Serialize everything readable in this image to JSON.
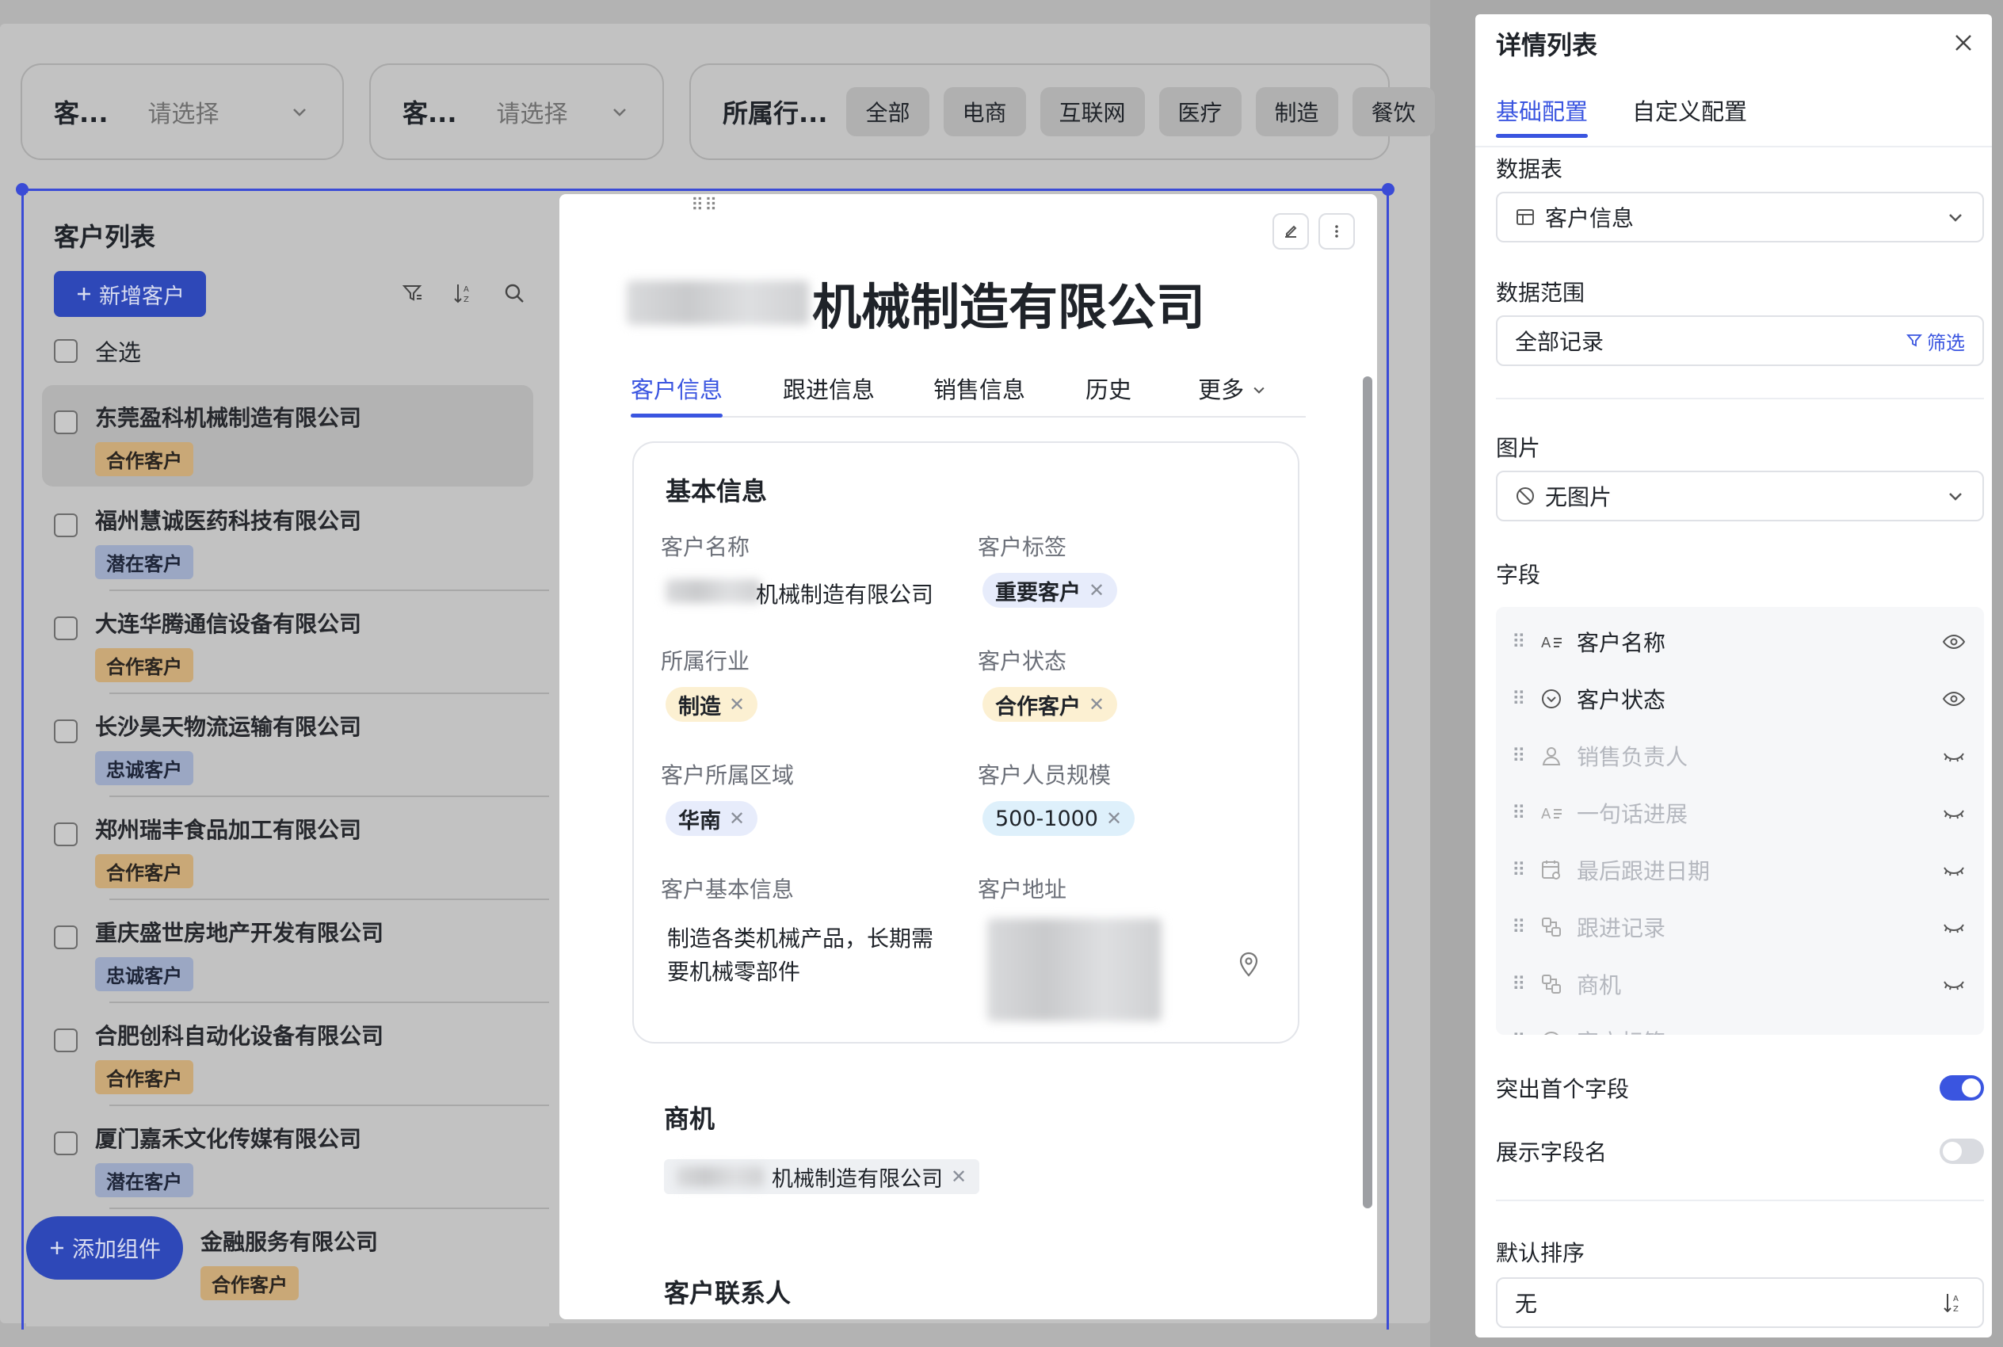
{
  "filters": [
    {
      "label": "客...",
      "placeholder": "请选择"
    },
    {
      "label": "客...",
      "placeholder": "请选择"
    },
    {
      "label": "所属行...",
      "chips": [
        "全部",
        "电商",
        "互联网",
        "医疗",
        "制造",
        "餐饮"
      ]
    }
  ],
  "customer_list": {
    "title": "客户列表",
    "add_button": "新增客户",
    "select_all": "全选",
    "items": [
      {
        "name": "东莞盈科机械制造有限公司",
        "status": "合作客户"
      },
      {
        "name": "福州慧诚医药科技有限公司",
        "status": "潜在客户"
      },
      {
        "name": "大连华腾通信设备有限公司",
        "status": "合作客户"
      },
      {
        "name": "长沙昊天物流运输有限公司",
        "status": "忠诚客户"
      },
      {
        "name": "郑州瑞丰食品加工有限公司",
        "status": "合作客户"
      },
      {
        "name": "重庆盛世房地产开发有限公司",
        "status": "忠诚客户"
      },
      {
        "name": "合肥创科自动化设备有限公司",
        "status": "合作客户"
      },
      {
        "name": "厦门嘉禾文化传媒有限公司",
        "status": "潜在客户"
      },
      {
        "name": "金融服务有限公司",
        "status": "合作客户"
      }
    ],
    "add_component_button": "添加组件"
  },
  "detail": {
    "title": "机械制造有限公司",
    "tabs": [
      "客户信息",
      "跟进信息",
      "销售信息",
      "历史",
      "更多"
    ],
    "basic_info": {
      "title": "基本信息",
      "fields": {
        "customer_name_label": "客户名称",
        "customer_name_value": "机械制造有限公司",
        "customer_tag_label": "客户标签",
        "customer_tag_value": "重要客户",
        "industry_label": "所属行业",
        "industry_value": "制造",
        "status_label": "客户状态",
        "status_value": "合作客户",
        "region_label": "客户所属区域",
        "region_value": "华南",
        "size_label": "客户人员规模",
        "size_value": "500-1000",
        "basic_info_label": "客户基本信息",
        "basic_info_value_line1": "制造各类机械产品，长期需",
        "basic_info_value_line2": "要机械零部件",
        "address_label": "客户地址"
      }
    },
    "opportunity": {
      "title": "商机",
      "value": "机械制造有限公司"
    },
    "contacts": {
      "title": "客户联系人"
    }
  },
  "config": {
    "title": "详情列表",
    "tabs": [
      "基础配置",
      "自定义配置"
    ],
    "datatable_label": "数据表",
    "datatable_value": "客户信息",
    "range_label": "数据范围",
    "range_value": "全部记录",
    "range_filter": "筛选",
    "image_label": "图片",
    "image_value": "无图片",
    "fields_label": "字段",
    "fields": [
      {
        "name": "客户名称",
        "icon": "text-icon",
        "visible": true
      },
      {
        "name": "客户状态",
        "icon": "status-icon",
        "visible": true
      },
      {
        "name": "销售负责人",
        "icon": "person-icon",
        "visible": false
      },
      {
        "name": "一句话进展",
        "icon": "text-icon",
        "visible": false
      },
      {
        "name": "最后跟进日期",
        "icon": "date-icon",
        "visible": false
      },
      {
        "name": "跟进记录",
        "icon": "link-icon",
        "visible": false
      },
      {
        "name": "商机",
        "icon": "link-icon",
        "visible": false
      },
      {
        "name": "客户标签",
        "icon": "status-icon",
        "visible": false
      }
    ],
    "highlight_first_label": "突出首个字段",
    "highlight_first_on": true,
    "show_field_name_label": "展示字段名",
    "show_field_name_on": false,
    "default_sort_label": "默认排序",
    "default_sort_value": "无"
  }
}
